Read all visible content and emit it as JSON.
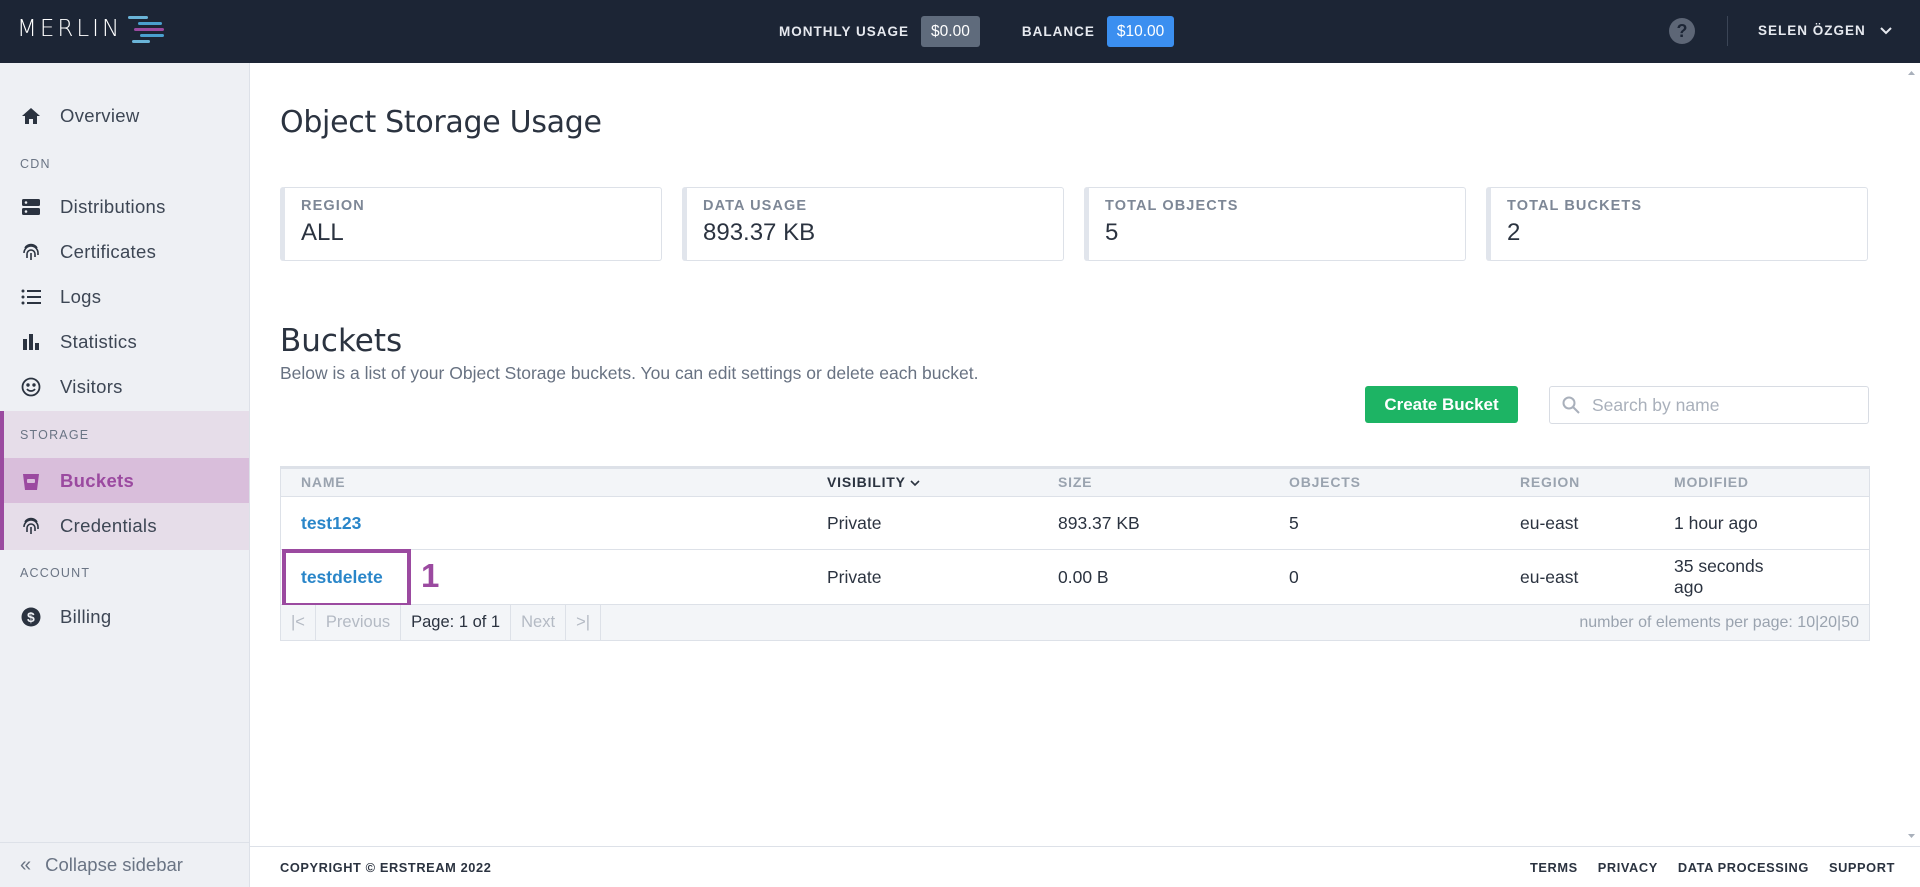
{
  "header": {
    "logo_text": "MERLIN",
    "monthly_usage_label": "MONTHLY USAGE",
    "monthly_usage_value": "$0.00",
    "balance_label": "BALANCE",
    "balance_value": "$10.00",
    "help_icon": "?",
    "user_name": "SELEN ÖZGEN"
  },
  "sidebar": {
    "overview": "Overview",
    "cdn_section": "CDN",
    "distributions": "Distributions",
    "certificates": "Certificates",
    "logs": "Logs",
    "statistics": "Statistics",
    "visitors": "Visitors",
    "storage_section": "STORAGE",
    "buckets": "Buckets",
    "credentials": "Credentials",
    "account_section": "ACCOUNT",
    "billing": "Billing",
    "collapse": "Collapse sidebar"
  },
  "page": {
    "title": "Object Storage Usage",
    "cards": [
      {
        "label": "REGION",
        "value": "ALL"
      },
      {
        "label": "DATA USAGE",
        "value": "893.37 KB"
      },
      {
        "label": "TOTAL OBJECTS",
        "value": "5"
      },
      {
        "label": "TOTAL BUCKETS",
        "value": "2"
      }
    ],
    "buckets_title": "Buckets",
    "buckets_subtitle": "Below is a list of your Object Storage buckets. You can edit settings or delete each bucket.",
    "create_button": "Create Bucket",
    "search_placeholder": "Search by name"
  },
  "table": {
    "headers": [
      "NAME",
      "VISIBILITY",
      "SIZE",
      "OBJECTS",
      "REGION",
      "MODIFIED"
    ],
    "rows": [
      {
        "name": "test123",
        "visibility": "Private",
        "size": "893.37 KB",
        "objects": "5",
        "region": "eu-east",
        "modified": "1 hour ago"
      },
      {
        "name": "testdelete",
        "visibility": "Private",
        "size": "0.00 B",
        "objects": "0",
        "region": "eu-east",
        "modified_line1": "35 seconds",
        "modified_line2": "ago"
      }
    ],
    "annotation": "1",
    "pager": {
      "first": "|<",
      "previous": "Previous",
      "page_label": "Page: 1 of 1",
      "next": "Next",
      "last": ">|",
      "per_page_label": "number of elements per page:",
      "per_page_options": [
        "10",
        "20",
        "50"
      ]
    }
  },
  "footer": {
    "copyright": "COPYRIGHT © ERSTREAM 2022",
    "links": [
      "TERMS",
      "PRIVACY",
      "DATA PROCESSING",
      "SUPPORT"
    ]
  },
  "colors": {
    "accent": "#9b4aa0",
    "topbar": "#1c2535",
    "create": "#1db464",
    "balance": "#3b8ff0"
  }
}
